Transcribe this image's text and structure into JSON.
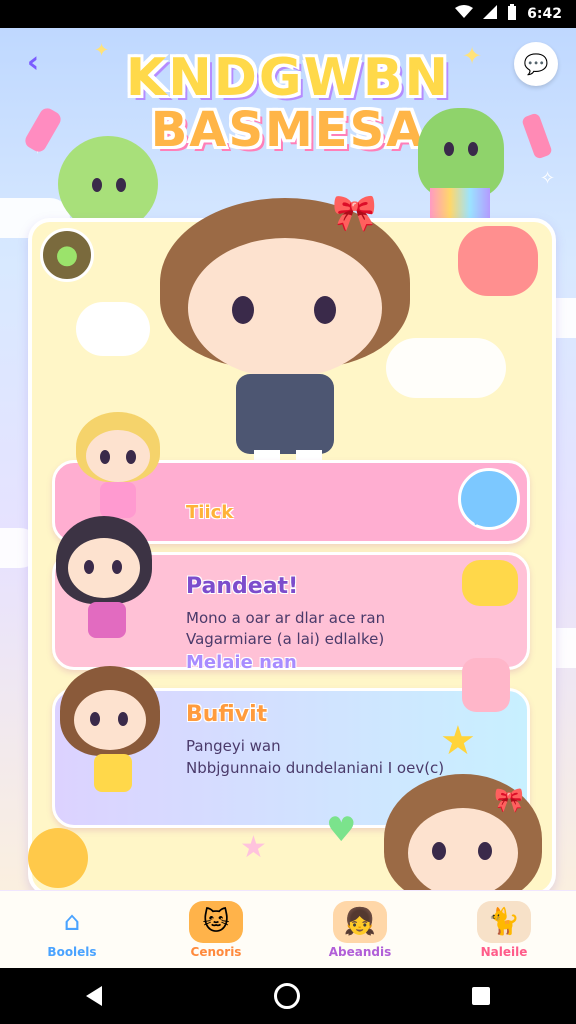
{
  "status_bar": {
    "time": "6:42",
    "icons": [
      "wifi-icon",
      "signal-icon",
      "battery-icon"
    ]
  },
  "header": {
    "title_line1": "KNDGWBN",
    "title_line2": "BASMESA",
    "back_icon": "chevron-left-icon",
    "chat_icon": "speech-bubble-icon"
  },
  "cards": {
    "top": {
      "action_icon": "speech-bubble-icon"
    },
    "middle": {
      "tag": "Tiick",
      "title": "Pandeat!",
      "line1": "Mono a oar ar dlar ace ran",
      "line2": "Vagarmiare (a lai) edlalke)"
    },
    "bottom": {
      "tag": "Melaie nan",
      "title": "Bufivit",
      "line1": "Pangeyi wan",
      "line2": "Nbbjgunnaio dundelaniani I oev(c)"
    }
  },
  "bottom_nav": [
    {
      "label": "Boolels",
      "icon": "home-icon",
      "color": "#4aa3ff"
    },
    {
      "label": "Cenoris",
      "icon": "cat-face-icon",
      "color": "#ff8a3d"
    },
    {
      "label": "Abeandis",
      "icon": "girl-face-icon",
      "color": "#b15fd8"
    },
    {
      "label": "Naleile",
      "icon": "cat-face-icon",
      "color": "#ff5c8a"
    }
  ],
  "colors": {
    "accent": "#7b5cff",
    "panel": "#fff6c7",
    "pink": "#ffaed1",
    "title_yellow": "#ffd94a"
  }
}
